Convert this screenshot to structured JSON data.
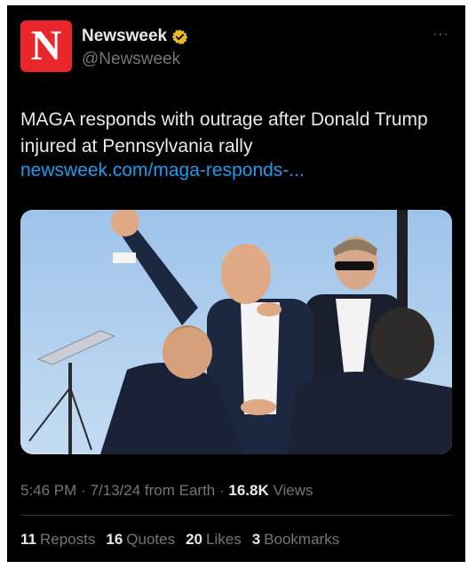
{
  "account": {
    "avatar_letter": "N",
    "name": "Newsweek",
    "handle": "@Newsweek",
    "verified_icon": "verified-badge-gold"
  },
  "more_label": "···",
  "tweet": {
    "text": "MAGA responds with outrage after Donald Trump injured at Pennsylvania rally",
    "link": "newsweek.com/maga-responds-..."
  },
  "meta": {
    "time": "5:46 PM",
    "date": "7/13/24",
    "source": "from Earth",
    "views_count": "16.8K",
    "views_label": "Views"
  },
  "stats": [
    {
      "count": "11",
      "label": "Reposts"
    },
    {
      "count": "16",
      "label": "Quotes"
    },
    {
      "count": "20",
      "label": "Likes"
    },
    {
      "count": "3",
      "label": "Bookmarks"
    }
  ],
  "colors": {
    "background": "#000000",
    "text": "#e7e9ea",
    "muted": "#71767b",
    "link": "#1d9bf0",
    "brand_red": "#e8262b",
    "verified_gold": "#e8b923"
  }
}
